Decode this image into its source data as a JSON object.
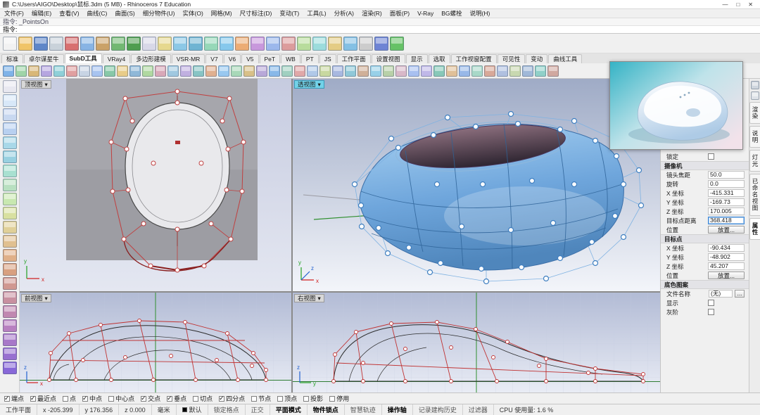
{
  "window": {
    "title": "C:\\Users\\AIGO\\Desktop\\鼠标.3dm (5 MB) - Rhinoceros 7 Education",
    "minimize": "—",
    "maximize": "□",
    "close": "✕"
  },
  "menu": {
    "items": [
      "文件(F)",
      "编辑(E)",
      "查看(V)",
      "曲线(C)",
      "曲面(S)",
      "细分物件(U)",
      "实体(O)",
      "网格(M)",
      "尺寸标注(D)",
      "变动(T)",
      "工具(L)",
      "分析(A)",
      "渲染(R)",
      "面板(P)",
      "V-Ray",
      "BG螺栓",
      "说明(H)"
    ]
  },
  "command": {
    "history": "指令: _PointsOn",
    "prompt": "指令:"
  },
  "toolbar_main": {
    "icons": [
      {
        "name": "new-file-icon",
        "color": "#f2f2f2"
      },
      {
        "name": "open-file-icon",
        "color": "#f0c468"
      },
      {
        "name": "save-icon",
        "color": "#5e86c8"
      },
      {
        "name": "print-icon",
        "color": "#c9d2da"
      },
      {
        "name": "cut-icon",
        "color": "#d87070"
      },
      {
        "name": "copy-icon",
        "color": "#88b4e4"
      },
      {
        "name": "paste-icon",
        "color": "#caa268"
      },
      {
        "name": "undo-icon",
        "color": "#72b872"
      },
      {
        "name": "redo-icon",
        "color": "#4f9e4f"
      },
      {
        "name": "select-icon",
        "color": "#d8d8e8"
      },
      {
        "name": "pan-view-icon",
        "color": "#e6d88e"
      },
      {
        "name": "zoom-window-icon",
        "color": "#8cc8e6"
      },
      {
        "name": "zoom-extents-icon",
        "color": "#6fb4d2"
      },
      {
        "name": "rotate-view-icon",
        "color": "#96d8b8"
      },
      {
        "name": "move-icon",
        "color": "#86c8ec"
      },
      {
        "name": "rotate-object-icon",
        "color": "#ecac74"
      },
      {
        "name": "scale-object-icon",
        "color": "#c898dc"
      },
      {
        "name": "mirror-icon",
        "color": "#9cb8ec"
      },
      {
        "name": "trim-icon",
        "color": "#dc9c9c"
      },
      {
        "name": "split-icon",
        "color": "#b8dc9c"
      },
      {
        "name": "join-icon",
        "color": "#9cdcdc"
      },
      {
        "name": "layers-icon",
        "color": "#e4cc84"
      },
      {
        "name": "properties-icon",
        "color": "#84c0e4"
      },
      {
        "name": "object-snap-icon",
        "color": "#cccccc"
      },
      {
        "name": "render-icon",
        "color": "#6e84d4"
      },
      {
        "name": "help-icon",
        "color": "#66c266"
      }
    ]
  },
  "tab_bar": {
    "tabs": [
      {
        "label": "标准"
      },
      {
        "label": "卓尔谋星牛"
      },
      {
        "label": "SubD工具",
        "active": true
      },
      {
        "label": "VRay4"
      },
      {
        "label": "多边形建模"
      },
      {
        "label": "VSR-MR"
      },
      {
        "label": "V7"
      },
      {
        "label": "V6"
      },
      {
        "label": "V5"
      },
      {
        "label": "PeT"
      },
      {
        "label": "WB"
      },
      {
        "label": "PT"
      },
      {
        "label": "JS"
      },
      {
        "label": "工作平面"
      },
      {
        "label": "设置视图"
      },
      {
        "label": "显示"
      },
      {
        "label": "选取"
      },
      {
        "label": "工作视窗配置"
      },
      {
        "label": "可见性"
      },
      {
        "label": "变动"
      },
      {
        "label": "曲线工具"
      }
    ]
  },
  "toolbar_secondary": {
    "icons": [
      {
        "name": "subd-display-toggle-icon",
        "color": "#7fb3e8"
      },
      {
        "name": "subd-box-icon",
        "color": "#9fd4a8"
      },
      {
        "name": "subd-plane-icon",
        "color": "#d8b778"
      },
      {
        "name": "subd-cylinder-icon",
        "color": "#b6a6e0"
      },
      {
        "name": "subd-sphere-icon",
        "color": "#8fd0d8"
      },
      {
        "name": "subd-torus-icon",
        "color": "#e0a0a0"
      },
      {
        "name": "subd-from-mesh-icon",
        "color": "#c8d4e4"
      },
      {
        "name": "subd-loft-icon",
        "color": "#a8c4f0"
      },
      {
        "name": "subd-sweep-icon",
        "color": "#88c8a8"
      },
      {
        "name": "subd-extrude-icon",
        "color": "#e8cc88"
      },
      {
        "name": "subd-offset-icon",
        "color": "#90b8d8"
      },
      {
        "name": "subd-thicken-icon",
        "color": "#b0d8a0"
      },
      {
        "name": "subd-fill-hole-icon",
        "color": "#d8a8b8"
      },
      {
        "name": "subd-bridge-icon",
        "color": "#a0c8e0"
      },
      {
        "name": "subd-stitch-icon",
        "color": "#c0b0e0"
      },
      {
        "name": "subd-merge-faces-icon",
        "color": "#88c4c4"
      },
      {
        "name": "subd-delete-faces-icon",
        "color": "#e0b090"
      },
      {
        "name": "subd-insert-edge-icon",
        "color": "#98c8f0"
      },
      {
        "name": "subd-insert-point-icon",
        "color": "#a8d8b8"
      },
      {
        "name": "subd-crease-icon",
        "color": "#d8c088"
      },
      {
        "name": "subd-remove-crease-icon",
        "color": "#b8a8d8"
      },
      {
        "name": "subd-bevel-icon",
        "color": "#88b8e8"
      },
      {
        "name": "subd-slide-edge-icon",
        "color": "#a0d0c0"
      },
      {
        "name": "subd-symmetry-icon",
        "color": "#e0a8a8"
      },
      {
        "name": "subd-reflect-icon",
        "color": "#b0c8e8"
      },
      {
        "name": "subd-radiate-icon",
        "color": "#c8d8a0"
      },
      {
        "name": "subd-align-vertices-icon",
        "color": "#a8b8e0"
      },
      {
        "name": "subd-to-nurbs-icon",
        "color": "#90c8d8"
      },
      {
        "name": "subd-to-mesh-icon",
        "color": "#d0b098"
      },
      {
        "name": "control-points-on-icon",
        "color": "#98d0e8"
      },
      {
        "name": "control-points-off-icon",
        "color": "#b8d0a8"
      },
      {
        "name": "move-uvn-icon",
        "color": "#d8b8c8"
      },
      {
        "name": "gumball-toggle-icon",
        "color": "#a8c0f0"
      },
      {
        "name": "soft-move-icon",
        "color": "#c0b8e8"
      },
      {
        "name": "smooth-subd-icon",
        "color": "#88c8b8"
      },
      {
        "name": "rebuild-subd-icon",
        "color": "#e0c098"
      },
      {
        "name": "mirror-tool-icon",
        "color": "#98b8e8"
      },
      {
        "name": "array-tool-icon",
        "color": "#a8d8c8"
      },
      {
        "name": "orient-tool-icon",
        "color": "#d8a898"
      },
      {
        "name": "project-tool-icon",
        "color": "#b0c0e0"
      },
      {
        "name": "pull-tool-icon",
        "color": "#c8d8b0"
      },
      {
        "name": "split-tool-icon",
        "color": "#a0b8d8"
      },
      {
        "name": "join-tool-icon",
        "color": "#90d0c8"
      },
      {
        "name": "explode-tool-icon",
        "color": "#d0a8a0"
      }
    ]
  },
  "left_toolbar": {
    "icons": [
      {
        "name": "select-tool-icon",
        "color": "#e8e8f0"
      },
      {
        "name": "points-tool-icon",
        "color": "#d8e8f8"
      },
      {
        "name": "line-tool-icon",
        "color": "#c8d8f0"
      },
      {
        "name": "polyline-tool-icon",
        "color": "#b8d0f0"
      },
      {
        "name": "circle-tool-icon",
        "color": "#a8d8e8"
      },
      {
        "name": "arc-tool-icon",
        "color": "#98d0e0"
      },
      {
        "name": "ellipse-tool-icon",
        "color": "#a8e0d0"
      },
      {
        "name": "rectangle-tool-icon",
        "color": "#b8e0c0"
      },
      {
        "name": "polygon-tool-icon",
        "color": "#c8e8b0"
      },
      {
        "name": "curve-tool-icon",
        "color": "#d8e0a0"
      },
      {
        "name": "surface-tool-icon",
        "color": "#e0d098"
      },
      {
        "name": "loft-tool-icon",
        "color": "#e0c090"
      },
      {
        "name": "sweep-tool-icon",
        "color": "#e0b088"
      },
      {
        "name": "revolve-tool-icon",
        "color": "#d8a080"
      },
      {
        "name": "box-tool-icon",
        "color": "#d09890"
      },
      {
        "name": "sphere-tool-icon",
        "color": "#c890a0"
      },
      {
        "name": "cylinder-tool-icon",
        "color": "#c088b0"
      },
      {
        "name": "boolean-tool-icon",
        "color": "#b880c0"
      },
      {
        "name": "trim-tool-icon",
        "color": "#a878c8"
      },
      {
        "name": "fillet-tool-icon",
        "color": "#9870d0"
      },
      {
        "name": "explode-side-icon",
        "color": "#8868d8"
      }
    ]
  },
  "viewports": {
    "top": {
      "label": "顶视图",
      "menu_arrow": "▾",
      "axes": {
        "x": "x",
        "y": "y"
      }
    },
    "perspective": {
      "label": "透视图",
      "menu_arrow": "▾",
      "axes": {
        "x": "x",
        "y": "y",
        "z": "z"
      }
    },
    "front": {
      "label": "前视图",
      "menu_arrow": "▾",
      "axes": {
        "x": "x",
        "z": "z"
      }
    },
    "right": {
      "label": "右视图",
      "menu_arrow": "▾",
      "axes": {
        "y": "y",
        "z": "z"
      }
    }
  },
  "properties_panel": {
    "lock_label": "锁定",
    "camera_title": "摄像机",
    "camera_rows": [
      {
        "label": "镜头焦距",
        "value": "50.0"
      },
      {
        "label": "旋转",
        "value": "0.0"
      },
      {
        "label": "X 坐标",
        "value": "-415.331"
      },
      {
        "label": "Y 坐标",
        "value": "-169.73"
      },
      {
        "label": "Z 坐标",
        "value": "170.005"
      },
      {
        "label": "目标点距离",
        "value": "368.418",
        "focus": true
      }
    ],
    "camera_place_label": "位置",
    "camera_place_btn": "放置...",
    "target_title": "目标点",
    "target_rows": [
      {
        "label": "X 坐标",
        "value": "-90.434"
      },
      {
        "label": "Y 坐标",
        "value": "-48.902"
      },
      {
        "label": "Z 坐标",
        "value": "45.207"
      }
    ],
    "target_place_label": "位置",
    "target_place_btn": "放置...",
    "wallpaper_title": "底色图案",
    "filename_label": "文件名称",
    "filename_value": "(无)",
    "browse_label": "...",
    "show_label": "显示",
    "gray_label": "灰阶"
  },
  "side_strip": {
    "tabs": [
      {
        "label": "渲染"
      },
      {
        "label": "说明"
      },
      {
        "label": "灯光"
      },
      {
        "label": "已命名视图"
      },
      {
        "label": "属性",
        "active": true
      }
    ]
  },
  "osnap_bar": {
    "items": [
      {
        "label": "端点",
        "checked": true
      },
      {
        "label": "最近点",
        "checked": true
      },
      {
        "label": "点",
        "checked": false
      },
      {
        "label": "中点",
        "checked": true
      },
      {
        "label": "中心点",
        "checked": false
      },
      {
        "label": "交点",
        "checked": true
      },
      {
        "label": "垂点",
        "checked": true
      },
      {
        "label": "切点",
        "checked": false
      },
      {
        "label": "四分点",
        "checked": true
      },
      {
        "label": "节点",
        "checked": false
      },
      {
        "label": "顶点",
        "checked": false
      },
      {
        "label": "投影",
        "checked": false
      },
      {
        "label": "停用",
        "checked": false
      }
    ]
  },
  "status_bar": {
    "cplane": "工作平面",
    "x": "x -205.399",
    "y": "y 176.356",
    "z": "z 0.000",
    "units": "毫米",
    "layer": "默认",
    "toggles": [
      {
        "label": "锁定格点"
      },
      {
        "label": "正交"
      },
      {
        "label": "平面模式",
        "bold": true
      },
      {
        "label": "物件锁点",
        "bold": true
      },
      {
        "label": "智慧轨迹"
      },
      {
        "label": "操作轴",
        "bold": true
      },
      {
        "label": "记录建构历史"
      },
      {
        "label": "过滤器"
      }
    ],
    "cpu": "CPU 使用量: 1.6 %"
  },
  "colors": {
    "accent_active_viewport": "#72d2e8",
    "subd_body_blue": "#5f9cd4",
    "cage_red": "#c04040",
    "control_point_blue": "#3f7fc0"
  }
}
